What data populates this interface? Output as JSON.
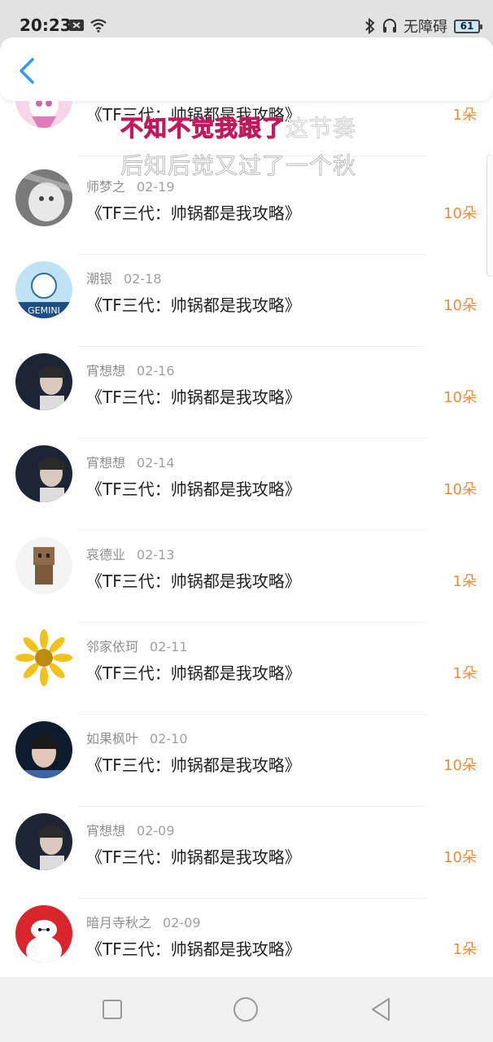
{
  "status_bar": {
    "time": "20:23",
    "network_label": "无障碍",
    "battery": "61",
    "icons": [
      "notification-icon",
      "wifi-icon",
      "bluetooth-icon",
      "headphones-icon",
      "battery-icon"
    ]
  },
  "header": {
    "back_icon": "chevron-left-icon",
    "accent": "#2b9cf2"
  },
  "lyrics": {
    "line1_highlight": "不知不觉我跟了",
    "line1_rest": "这节奏",
    "line2": "后知后觉又过了一个秋"
  },
  "rows": [
    {
      "user": "",
      "date": "",
      "title": "《TF三代：帅锅都是我攻略》",
      "amount": "1朵"
    },
    {
      "user": "师梦之",
      "date": "02-19",
      "title": "《TF三代：帅锅都是我攻略》",
      "amount": "10朵"
    },
    {
      "user": "潮银",
      "date": "02-18",
      "title": "《TF三代：帅锅都是我攻略》",
      "amount": "10朵"
    },
    {
      "user": "宵想想",
      "date": "02-16",
      "title": "《TF三代：帅锅都是我攻略》",
      "amount": "10朵"
    },
    {
      "user": "宵想想",
      "date": "02-14",
      "title": "《TF三代：帅锅都是我攻略》",
      "amount": "10朵"
    },
    {
      "user": "哀德业",
      "date": "02-13",
      "title": "《TF三代：帅锅都是我攻略》",
      "amount": "1朵"
    },
    {
      "user": "邻家依珂",
      "date": "02-11",
      "title": "《TF三代：帅锅都是我攻略》",
      "amount": "1朵"
    },
    {
      "user": "如果枫叶",
      "date": "02-10",
      "title": "《TF三代：帅锅都是我攻略》",
      "amount": "10朵"
    },
    {
      "user": "宵想想",
      "date": "02-09",
      "title": "《TF三代：帅锅都是我攻略》",
      "amount": "10朵"
    },
    {
      "user": "暗月寺秋之",
      "date": "02-09",
      "title": "《TF三代：帅锅都是我攻略》",
      "amount": "1朵"
    }
  ],
  "navbar": {
    "icons": [
      "recents-square-icon",
      "home-circle-icon",
      "back-triangle-icon"
    ]
  },
  "colors": {
    "amount": "#f08a3c",
    "accent": "#2b9cf2",
    "lyric_highlight": "#e91e63"
  }
}
